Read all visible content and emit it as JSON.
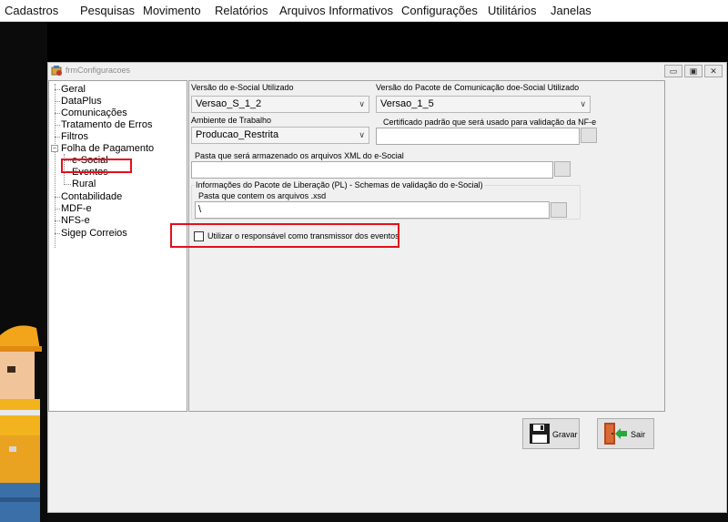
{
  "menu": {
    "items": [
      "Cadastros",
      "Pesquisas",
      "Movimento",
      "Relatórios",
      "Arquivos Informativos",
      "Configurações",
      "Utilitários",
      "Janelas"
    ]
  },
  "window": {
    "title": "frmConfiguracoes",
    "controls": {
      "minimize": "▭",
      "maximize": "▣",
      "close": "✕"
    }
  },
  "tree": {
    "nodes": {
      "geral": "Geral",
      "dataplus": "DataPlus",
      "comunicacoes": "Comunicações",
      "tratamento": "Tratamento de Erros",
      "filtros": "Filtros",
      "folha": "Folha de Pagamento",
      "esocial": "e-Social",
      "eventos": "Eventos",
      "rural": "Rural",
      "contabilidade": "Contabilidade",
      "mdfe": "MDF-e",
      "nfse": "NFS-e",
      "sigep": "Sigep Correios"
    },
    "folha_expander": "−"
  },
  "esocial": {
    "versao_label": "Versão do e-Social Utilizado",
    "versao_value": "Versao_S_1_2",
    "pacote_label": "Versão do Pacote de Comunicação doe-Social Utilizado",
    "pacote_value": "Versao_1_5",
    "ambiente_label": "Ambiente de Trabalho",
    "ambiente_value": "Producao_Restrita",
    "certificado_label": "Certificado padrão que será usado para validação da NF-e",
    "certificado_value": "",
    "pasta_xml_label": "Pasta que será armazenado os arquivos XML do e-Social",
    "pasta_xml_value": "",
    "pl_group_label": "Informações do Pacote de Liberação (PL) - Schemas de validação do e-Social)",
    "pasta_xsd_label": "Pasta que contem os arquivos .xsd",
    "pasta_xsd_value": "\\",
    "checkbox_label": "Utilizar o responsável como transmissor dos eventos",
    "checkbox_checked": false
  },
  "buttons": {
    "gravar": "Gravar",
    "sair": "Sair"
  },
  "colors": {
    "annotation_red": "#e3101a",
    "window_bg": "#f0f0f0"
  }
}
